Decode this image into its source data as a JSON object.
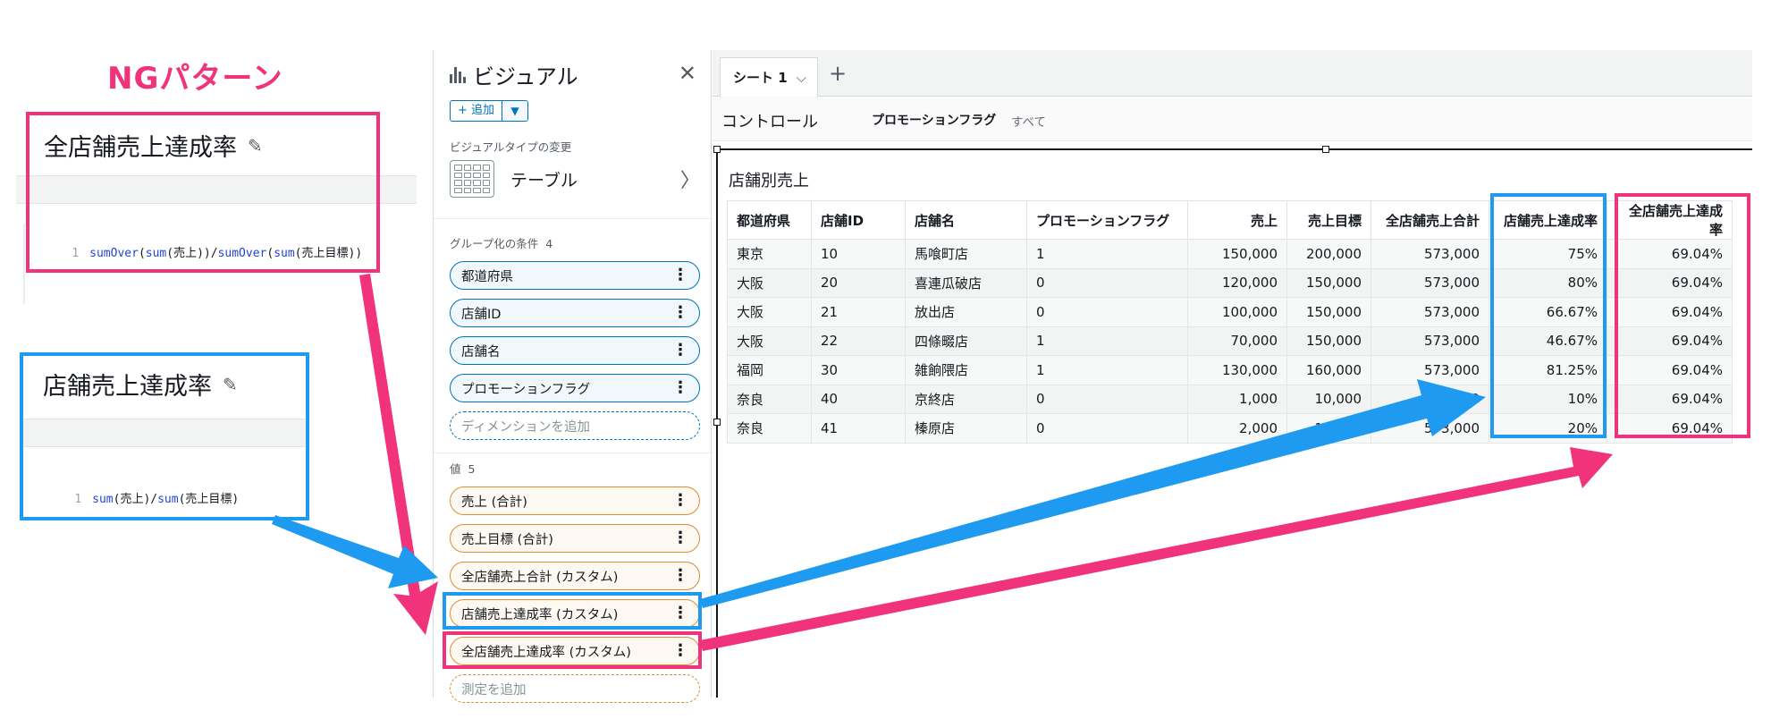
{
  "annotation": {
    "ng_title": "NGパターン"
  },
  "formula_cards": [
    {
      "title": "全店舗売上達成率",
      "line_no": "1",
      "code_parts": [
        "sumOver",
        "(",
        "sum",
        "(売上))/",
        "sumOver",
        "(",
        "sum",
        "(売上目標))"
      ]
    },
    {
      "title": "店舗売上達成率",
      "line_no": "1",
      "code_parts": [
        "sum",
        "(売上)/",
        "sum",
        "(売上目標)"
      ]
    }
  ],
  "panel": {
    "title": "ビジュアル",
    "add_label": "+ 追加",
    "vis_type_label": "ビジュアルタイプの変更",
    "vis_type_name": "テーブル",
    "group_section": "グループ化の条件",
    "group_count": "4",
    "group_fields": [
      "都道府県",
      "店舗ID",
      "店舗名",
      "プロモーションフラグ"
    ],
    "add_dimension": "ディメンションを追加",
    "value_section": "値",
    "value_count": "5",
    "value_fields": [
      "売上 (合計)",
      "売上目標 (合計)",
      "全店舗売上合計 (カスタム)",
      "店舗売上達成率 (カスタム)",
      "全店舗売上達成率 (カスタム)"
    ],
    "add_measure": "測定を追加"
  },
  "sheet": {
    "tab_label": "シート 1",
    "control_label": "コントロール",
    "control_flag": "プロモーションフラグ",
    "control_flag_value": "すべて",
    "visual_title": "店舗別売上"
  },
  "table": {
    "columns": [
      "都道府県",
      "店舗ID",
      "店舗名",
      "プロモーションフラグ",
      "売上",
      "売上目標",
      "全店舗売上合計",
      "店舗売上達成率",
      "全店舗売上達成率"
    ],
    "rows": [
      [
        "東京",
        "10",
        "馬喰町店",
        "1",
        "150,000",
        "200,000",
        "573,000",
        "75%",
        "69.04%"
      ],
      [
        "大阪",
        "20",
        "喜連瓜破店",
        "0",
        "120,000",
        "150,000",
        "573,000",
        "80%",
        "69.04%"
      ],
      [
        "大阪",
        "21",
        "放出店",
        "0",
        "100,000",
        "150,000",
        "573,000",
        "66.67%",
        "69.04%"
      ],
      [
        "大阪",
        "22",
        "四條畷店",
        "1",
        "70,000",
        "150,000",
        "573,000",
        "46.67%",
        "69.04%"
      ],
      [
        "福岡",
        "30",
        "雑餉隈店",
        "1",
        "130,000",
        "160,000",
        "573,000",
        "81.25%",
        "69.04%"
      ],
      [
        "奈良",
        "40",
        "京終店",
        "0",
        "1,000",
        "10,000",
        "573,000",
        "10%",
        "69.04%"
      ],
      [
        "奈良",
        "41",
        "榛原店",
        "0",
        "2,000",
        "10,000",
        "573,000",
        "20%",
        "69.04%"
      ]
    ]
  },
  "colors": {
    "highlight_pink": "#f0337a",
    "highlight_blue": "#1e9bf0",
    "dimension_pill": "#0073bb",
    "measure_pill": "#d98f31"
  }
}
